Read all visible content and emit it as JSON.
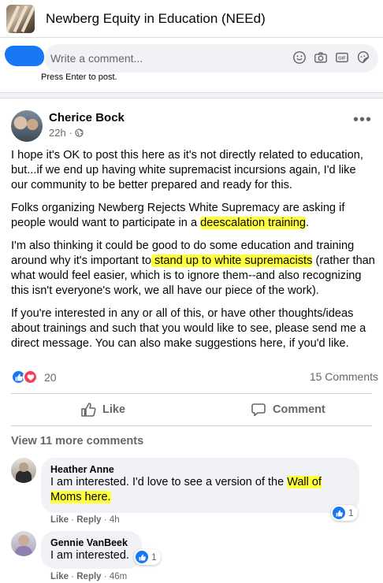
{
  "group": {
    "title": "Newberg Equity in Education (NEEd)"
  },
  "composer": {
    "placeholder": "Write a comment...",
    "hint": "Press Enter to post.",
    "icons": [
      "emoji-icon",
      "camera-icon",
      "gif-icon",
      "sticker-icon"
    ]
  },
  "post": {
    "author": "Cherice Bock",
    "time": "22h",
    "audience_icon": "globe-icon",
    "paragraphs": [
      {
        "segments": [
          {
            "text": "I hope it's OK to post this here as it's not directly related to education, but...if we end up having white supremacist incursions again, I'd like our community to be better prepared and ready for this.",
            "hl": false
          }
        ]
      },
      {
        "segments": [
          {
            "text": "Folks organizing Newberg Rejects White Supremacy are asking if people would want to participate in a ",
            "hl": false
          },
          {
            "text": "deescalation training",
            "hl": true
          },
          {
            "text": ".",
            "hl": false
          }
        ]
      },
      {
        "segments": [
          {
            "text": "I'm also thinking it could be good to do some education and training around why it's important to",
            "hl": false
          },
          {
            "text": " stand up to white supremacists",
            "hl": true
          },
          {
            "text": " (rather than what would feel easier, which is to ignore them--and also recognizing this isn't everyone's work, we all have our piece of the work).",
            "hl": false
          }
        ]
      },
      {
        "segments": [
          {
            "text": "If you're interested in any or all of this, or have other thoughts/ideas about trainings and such that you would like to see, please send me a direct message. You can also make suggestions here, if you'd like.",
            "hl": false
          }
        ]
      }
    ],
    "reaction_count": "20",
    "comment_count": "15 Comments",
    "like_label": "Like",
    "comment_label": "Comment",
    "view_more": "View 11 more comments"
  },
  "comments": [
    {
      "name": "Heather Anne",
      "segments": [
        {
          "text": "I am interested. I'd love to see a version of the ",
          "hl": false
        },
        {
          "text": "Wall of Moms here.",
          "hl": true
        }
      ],
      "reactions": "1",
      "like": "Like",
      "reply": "Reply",
      "time": "4h"
    },
    {
      "name": "Gennie VanBeek",
      "segments": [
        {
          "text": "I am interested.",
          "hl": false
        }
      ],
      "reactions": "1",
      "like": "Like",
      "reply": "Reply",
      "time": "46m"
    }
  ],
  "colors": {
    "highlight": "#ffff3b",
    "fb_blue": "#1877f2",
    "love": "#f33e58",
    "muted": "#65676b"
  }
}
